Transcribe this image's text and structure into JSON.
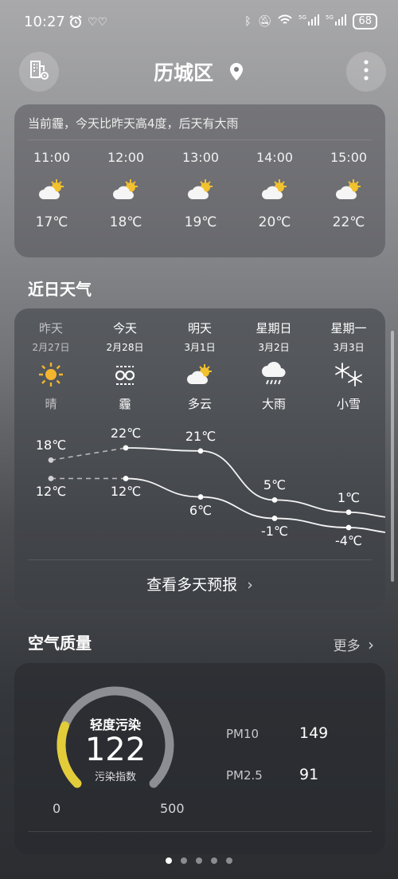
{
  "status_bar": {
    "time": "10:27",
    "battery": "68"
  },
  "header": {
    "city": "历城区"
  },
  "hourly": {
    "tip": "当前霾，今天比昨天高4度，后天有大雨",
    "hours": [
      {
        "time": "11:00",
        "temp": "17℃",
        "icon": "partly-cloudy-icon"
      },
      {
        "time": "12:00",
        "temp": "18℃",
        "icon": "partly-cloudy-icon"
      },
      {
        "time": "13:00",
        "temp": "19℃",
        "icon": "partly-cloudy-icon"
      },
      {
        "time": "14:00",
        "temp": "20℃",
        "icon": "partly-cloudy-icon"
      },
      {
        "time": "15:00",
        "temp": "22℃",
        "icon": "partly-cloudy-icon"
      }
    ]
  },
  "recent": {
    "title": "近日天气",
    "days": [
      {
        "name": "昨天",
        "date": "2月27日",
        "cond": "晴",
        "icon": "sun-icon",
        "high": "18℃",
        "low": "12℃"
      },
      {
        "name": "今天",
        "date": "2月28日",
        "cond": "霾",
        "icon": "haze-icon",
        "high": "22℃",
        "low": "12℃"
      },
      {
        "name": "明天",
        "date": "3月1日",
        "cond": "多云",
        "icon": "partly-cloudy-icon",
        "high": "21℃",
        "low": "6℃"
      },
      {
        "name": "星期日",
        "date": "3月2日",
        "cond": "大雨",
        "icon": "heavy-rain-icon",
        "high": "5℃",
        "low": "-1℃"
      },
      {
        "name": "星期一",
        "date": "3月3日",
        "cond": "小雪",
        "icon": "light-snow-icon",
        "high": "1℃",
        "low": "-4℃"
      }
    ],
    "more_forecast": "查看多天预报"
  },
  "air": {
    "title": "空气质量",
    "more": "更多",
    "level": "轻度污染",
    "index": "122",
    "index_label": "污染指数",
    "min": "0",
    "max": "500",
    "index_fraction": 0.244,
    "pm10_label": "PM10",
    "pm10_value": "149",
    "pm25_label": "PM2.5",
    "pm25_value": "91",
    "gauge_color": "#e3cc3a"
  },
  "pager": {
    "pages": 5,
    "active": 0
  }
}
